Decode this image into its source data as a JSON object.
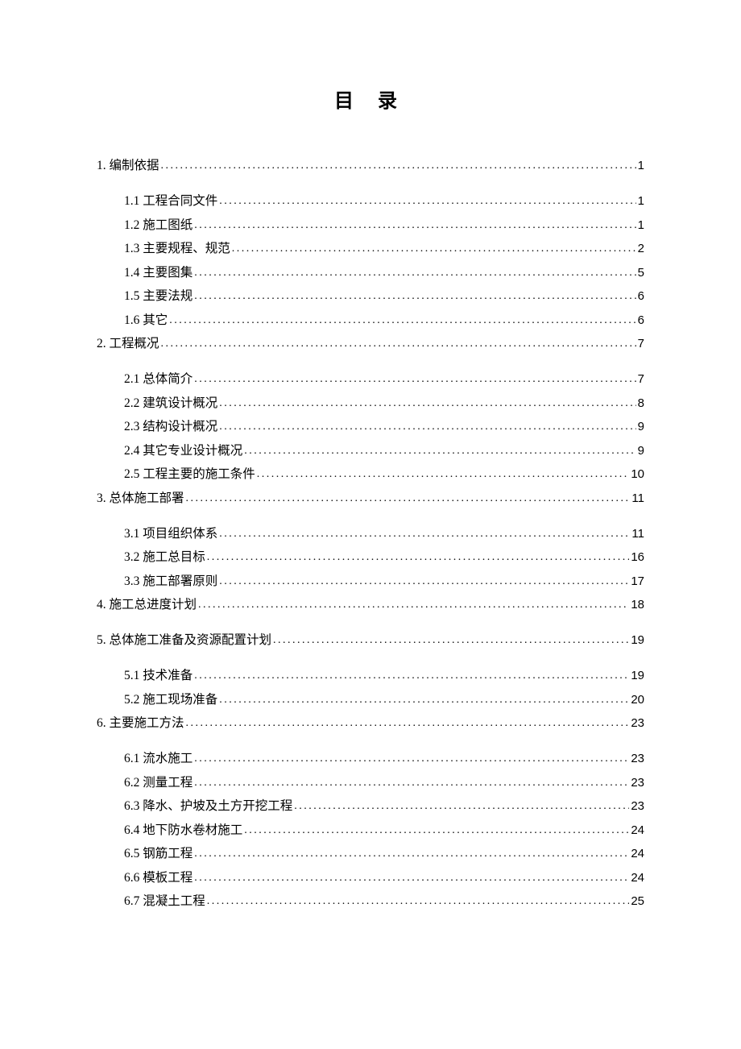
{
  "title": "目  录",
  "toc": [
    {
      "num": "1.",
      "label": "编制依据",
      "page": "1",
      "children": [
        {
          "num": "1.1",
          "label": "工程合同文件",
          "page": "1"
        },
        {
          "num": "1.2",
          "label": "施工图纸",
          "page": "1"
        },
        {
          "num": "1.3",
          "label": "主要规程、规范",
          "page": "2"
        },
        {
          "num": "1.4",
          "label": "主要图集",
          "page": "5"
        },
        {
          "num": "1.5",
          "label": "主要法规",
          "page": "6"
        },
        {
          "num": "1.6",
          "label": "其它",
          "page": "6"
        }
      ]
    },
    {
      "num": "2.",
      "label": "工程概况",
      "page": "7",
      "children": [
        {
          "num": "2.1",
          "label": "总体简介",
          "page": "7"
        },
        {
          "num": "2.2",
          "label": "建筑设计概况",
          "page": "8"
        },
        {
          "num": "2.3",
          "label": "结构设计概况",
          "page": "9"
        },
        {
          "num": "2.4",
          "label": "其它专业设计概况",
          "page": "9"
        },
        {
          "num": "2.5",
          "label": "工程主要的施工条件",
          "page": "10"
        }
      ]
    },
    {
      "num": "3.",
      "label": "总体施工部署",
      "page": "11",
      "children": [
        {
          "num": "3.1",
          "label": "项目组织体系",
          "page": "11"
        },
        {
          "num": "3.2",
          "label": "施工总目标",
          "page": "16"
        },
        {
          "num": "3.3",
          "label": "施工部署原则",
          "page": "17"
        }
      ]
    },
    {
      "num": "4.",
      "label": "施工总进度计划",
      "page": "18",
      "children": []
    },
    {
      "num": "5.",
      "label": "总体施工准备及资源配置计划",
      "page": "19",
      "children": [
        {
          "num": "5.1",
          "label": "技术准备",
          "page": "19"
        },
        {
          "num": "5.2",
          "label": "施工现场准备",
          "page": "20"
        }
      ]
    },
    {
      "num": "6.",
      "label": "主要施工方法",
      "page": "23",
      "children": [
        {
          "num": "6.1",
          "label": "流水施工",
          "page": "23"
        },
        {
          "num": "6.2",
          "label": "测量工程",
          "page": "23"
        },
        {
          "num": "6.3",
          "label": "降水、护坡及土方开挖工程",
          "page": "23"
        },
        {
          "num": "6.4",
          "label": "地下防水卷材施工",
          "page": "24"
        },
        {
          "num": "6.5",
          "label": "钢筋工程",
          "page": "24"
        },
        {
          "num": "6.6",
          "label": "模板工程",
          "page": "24"
        },
        {
          "num": "6.7",
          "label": "混凝土工程",
          "page": "25"
        }
      ]
    }
  ]
}
